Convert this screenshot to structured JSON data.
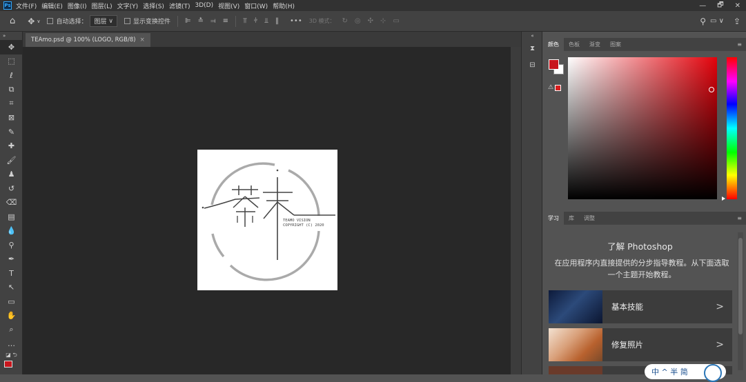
{
  "app": {
    "logo": "Ps"
  },
  "menu": [
    "文件(F)",
    "编辑(E)",
    "图像(I)",
    "图层(L)",
    "文字(Y)",
    "选择(S)",
    "滤镜(T)",
    "3D(D)",
    "视图(V)",
    "窗口(W)",
    "帮助(H)"
  ],
  "window_controls": {
    "minimize": "—",
    "restore": "🗗",
    "close": "✕"
  },
  "options": {
    "home_icon": "home-icon",
    "auto_select_label": "自动选择：",
    "auto_select_value": "图层",
    "show_transform_label": "显示变换控件",
    "more": "•••",
    "mode_3d_label": "3D 模式："
  },
  "document": {
    "tab_title": "TEAmo.psd @ 100% (LOGO, RGB/8)",
    "close": "×"
  },
  "logo_art": {
    "brand_text": "茶末",
    "line1": "TEAMO VISION",
    "line2": "COPYRIGHT (C) 2020"
  },
  "color_panel": {
    "tabs": [
      "颜色",
      "色板",
      "渐变",
      "图案"
    ],
    "active_tab": 0,
    "foreground": "#c8161d",
    "background": "#ffffff",
    "hue": "#e3020b"
  },
  "learn_panel": {
    "tabs": [
      "学习",
      "库",
      "调整"
    ],
    "title": "了解 Photoshop",
    "description": "在应用程序内直接提供的分步指导教程。从下面选取一个主题开始教程。",
    "lessons": [
      {
        "label": "基本技能",
        "arrow": ">"
      },
      {
        "label": "修复照片",
        "arrow": ">"
      }
    ]
  },
  "ime": {
    "text": "中 ^ 半 简"
  }
}
